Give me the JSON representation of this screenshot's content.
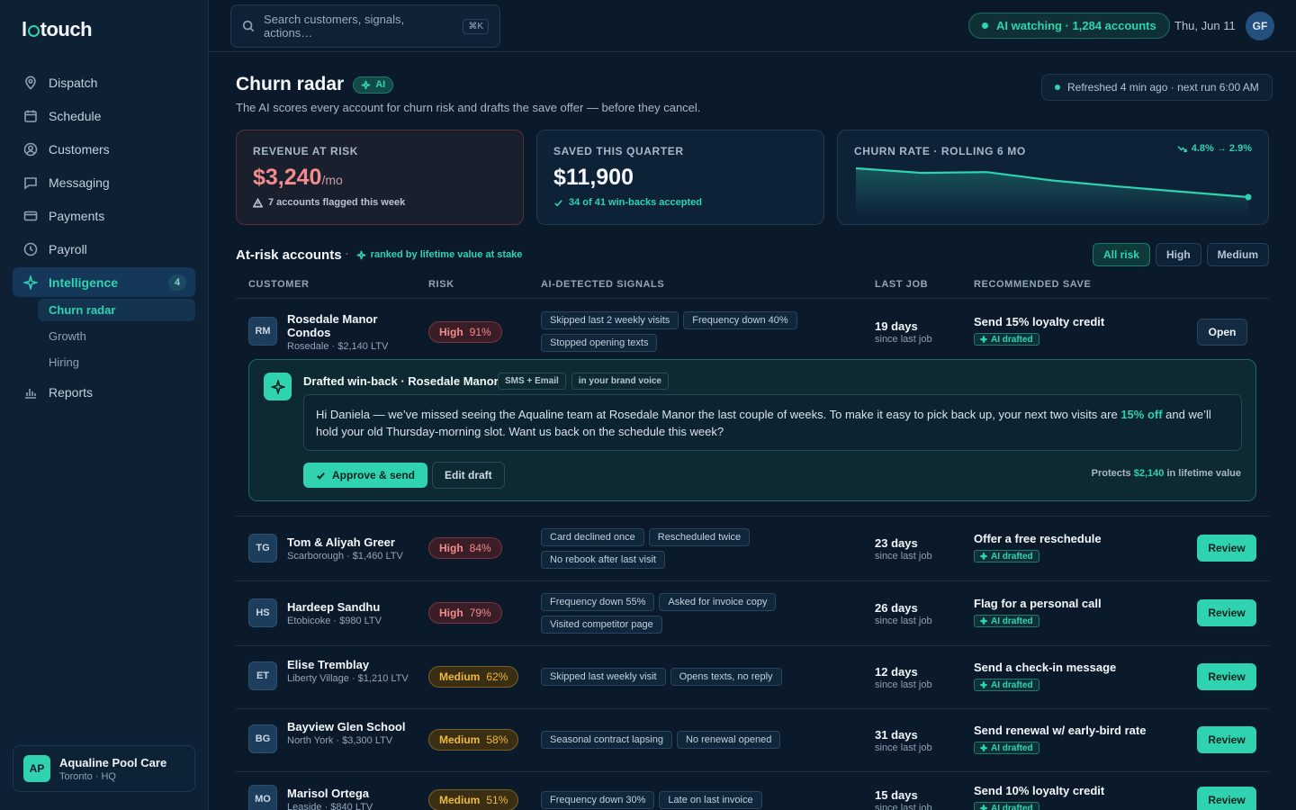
{
  "app": {
    "logo_prefix": "l",
    "logo_suffix": "touch"
  },
  "sidebar": {
    "items": [
      {
        "label": "Dispatch",
        "icon": "map-pin-icon"
      },
      {
        "label": "Schedule",
        "icon": "calendar-icon"
      },
      {
        "label": "Customers",
        "icon": "user-circle-icon"
      },
      {
        "label": "Messaging",
        "icon": "message-icon"
      },
      {
        "label": "Payments",
        "icon": "credit-card-icon"
      },
      {
        "label": "Payroll",
        "icon": "clock-icon"
      },
      {
        "label": "Intelligence",
        "icon": "sparkle-icon",
        "badge": "4"
      },
      {
        "label": "Reports",
        "icon": "bar-chart-icon"
      }
    ],
    "sub_items": [
      "Churn radar",
      "Growth",
      "Hiring"
    ],
    "org": {
      "initials": "AP",
      "name": "Aqualine Pool Care",
      "sub": "Toronto · HQ"
    }
  },
  "topbar": {
    "search_placeholder": "Search customers, signals, actions…",
    "search_shortcut": "⌘K",
    "ai_status": "AI watching · 1,284 accounts",
    "date": "Thu, Jun 11",
    "user_initials": "GF"
  },
  "header": {
    "title": "Churn radar",
    "ai_chip": "AI",
    "subtitle": "The AI scores every account for churn risk and drafts the save offer — before they cancel.",
    "refresh": "Refreshed 4 min ago · next run 6:00 AM"
  },
  "kpis": {
    "risk": {
      "label": "REVENUE AT RISK",
      "value": "$3,240",
      "unit": "/mo",
      "foot": "7 accounts flagged this week"
    },
    "saved": {
      "label": "SAVED THIS QUARTER",
      "value": "$11,900",
      "foot": "34 of 41 win-backs accepted"
    },
    "churn": {
      "label": "CHURN RATE · ROLLING 6 MO",
      "delta": "4.8% → 2.9%"
    }
  },
  "chart_data": {
    "type": "area",
    "title": "CHURN RATE · ROLLING 6 MO",
    "x": [
      1,
      2,
      3,
      4,
      5,
      6,
      7
    ],
    "values": [
      4.8,
      4.5,
      4.55,
      4.0,
      3.6,
      3.25,
      2.9
    ],
    "xlabel": "",
    "ylabel": "",
    "grid": false,
    "color": "#2fd3b0"
  },
  "section": {
    "title": "At-risk accounts",
    "note": "ranked by lifetime value at stake",
    "filters": [
      "All risk",
      "High",
      "Medium"
    ]
  },
  "table": {
    "headers": [
      "CUSTOMER",
      "RISK",
      "AI-DETECTED SIGNALS",
      "LAST JOB",
      "RECOMMENDED SAVE"
    ],
    "drafted_label": "AI drafted",
    "last_job_sub": "since last job",
    "rows": [
      {
        "initials": "RM",
        "name": "Rosedale Manor Condos",
        "sub": "Rosedale · $2,140 LTV",
        "risk": "High",
        "pct": "91%",
        "level": "high",
        "signals": [
          "Skipped last 2 weekly visits",
          "Frequency down 40%",
          "Stopped opening texts"
        ],
        "days": "19 days",
        "save": "Send 15% loyalty credit",
        "action": "Open"
      },
      {
        "initials": "TG",
        "name": "Tom & Aliyah Greer",
        "sub": "Scarborough · $1,460 LTV",
        "risk": "High",
        "pct": "84%",
        "level": "high",
        "signals": [
          "Card declined once",
          "Rescheduled twice",
          "No rebook after last visit"
        ],
        "days": "23 days",
        "save": "Offer a free reschedule",
        "action": "Review"
      },
      {
        "initials": "HS",
        "name": "Hardeep Sandhu",
        "sub": "Etobicoke · $980 LTV",
        "risk": "High",
        "pct": "79%",
        "level": "high",
        "signals": [
          "Frequency down 55%",
          "Asked for invoice copy",
          "Visited competitor page"
        ],
        "days": "26 days",
        "save": "Flag for a personal call",
        "action": "Review"
      },
      {
        "initials": "ET",
        "name": "Elise Tremblay",
        "sub": "Liberty Village · $1,210 LTV",
        "risk": "Medium",
        "pct": "62%",
        "level": "medium",
        "signals": [
          "Skipped last weekly visit",
          "Opens texts, no reply"
        ],
        "days": "12 days",
        "save": "Send a check-in message",
        "action": "Review"
      },
      {
        "initials": "BG",
        "name": "Bayview Glen School",
        "sub": "North York · $3,300 LTV",
        "risk": "Medium",
        "pct": "58%",
        "level": "medium",
        "signals": [
          "Seasonal contract lapsing",
          "No renewal opened"
        ],
        "days": "31 days",
        "save": "Send renewal w/ early-bird rate",
        "action": "Review"
      },
      {
        "initials": "MO",
        "name": "Marisol Ortega",
        "sub": "Leaside · $840 LTV",
        "risk": "Medium",
        "pct": "51%",
        "level": "medium",
        "signals": [
          "Frequency down 30%",
          "Late on last invoice"
        ],
        "days": "15 days",
        "save": "Send 10% loyalty credit",
        "action": "Review"
      }
    ]
  },
  "draft": {
    "title": "Drafted win-back · Rosedale Manor",
    "tags": [
      "SMS + Email",
      "in your brand voice"
    ],
    "body_before": "Hi Daniela — we’ve missed seeing the Aqualine team at Rosedale Manor the last couple of weeks. To make it easy to pick back up, your next two visits are ",
    "body_highlight": "15% off",
    "body_after": " and we’ll hold your old Thursday-morning slot. Want us back on the schedule this week?",
    "approve": "Approve & send",
    "edit": "Edit draft",
    "protects_before": "Protects",
    "protects_amount": "$2,140",
    "protects_after": "in lifetime value"
  }
}
